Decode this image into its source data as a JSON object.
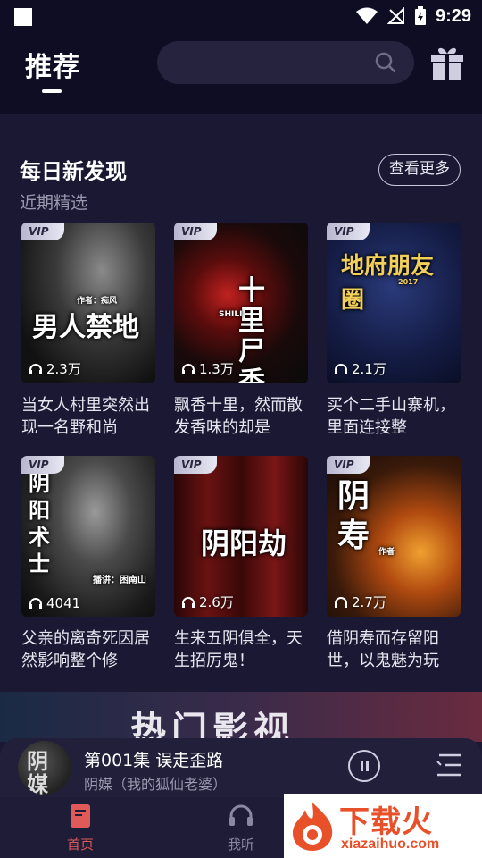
{
  "status_bar": {
    "time": "9:29"
  },
  "header": {
    "title": "推荐",
    "search_placeholder": ""
  },
  "section": {
    "title": "每日新发现",
    "subtitle": "近期精选",
    "more_label": "查看更多"
  },
  "books": [
    {
      "vip": "VIP",
      "plays": "2.3万",
      "desc": "当女人村里突然出现一名野和尚",
      "cover_title": "男人禁地",
      "cover_author": "作者：痴风"
    },
    {
      "vip": "VIP",
      "plays": "1.3万",
      "desc": "飘香十里，然而散发香味的却是",
      "cover_title": "十里尸香",
      "cover_author": "SHILI"
    },
    {
      "vip": "VIP",
      "plays": "2.1万",
      "desc": "买个二手山寨机，里面连接整",
      "cover_title": "地府朋友圈",
      "cover_author": "2017"
    },
    {
      "vip": "VIP",
      "plays": "4041",
      "desc": "父亲的离奇死因居然影响整个修",
      "cover_title": "阴阳术士",
      "cover_author": "播讲：困南山"
    },
    {
      "vip": "VIP",
      "plays": "2.6万",
      "desc": "生来五阴俱全，天生招厉鬼！",
      "cover_title": "阴阳劫",
      "cover_author": ""
    },
    {
      "vip": "VIP",
      "plays": "2.7万",
      "desc": "借阴寿而存留阳世，以鬼魅为玩",
      "cover_title": "阴寿",
      "cover_author": "作者"
    }
  ],
  "banner": {
    "text": "热门影视"
  },
  "player": {
    "title": "第001集 误走歪路",
    "subtitle": "阴媒（我的狐仙老婆）",
    "cover_text": "阴媒"
  },
  "nav": {
    "home": "首页",
    "listen": "我听"
  },
  "watermark": {
    "text": "下载火",
    "url": "xiazaihuo.com"
  },
  "colors": {
    "background": "#1a1833",
    "header": "#0f0d24",
    "nav_active": "#e05a5a",
    "nav_inactive": "#8a88a0"
  }
}
